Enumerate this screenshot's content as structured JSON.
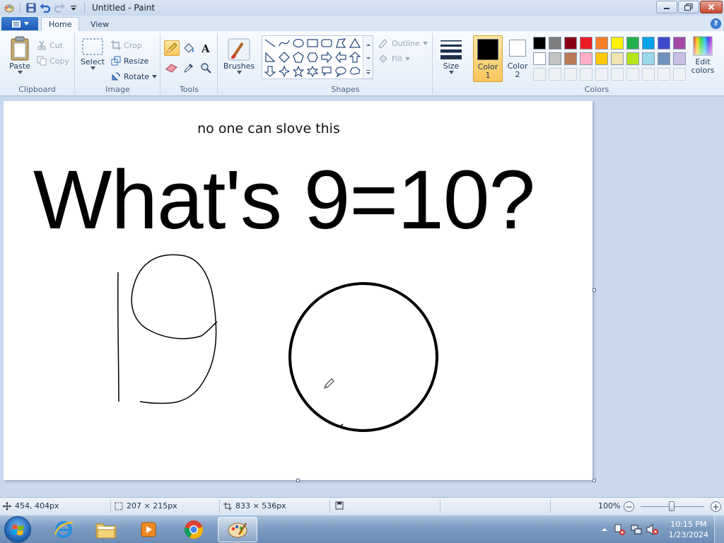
{
  "window": {
    "title": "Untitled - Paint"
  },
  "tabs": [
    {
      "label": "Home"
    },
    {
      "label": "View"
    }
  ],
  "clipboard": {
    "paste": "Paste",
    "cut": "Cut",
    "copy": "Copy",
    "label": "Clipboard"
  },
  "image": {
    "select": "Select",
    "crop": "Crop",
    "resize": "Resize",
    "rotate": "Rotate",
    "label": "Image"
  },
  "tools": {
    "label": "Tools",
    "selected": "pencil"
  },
  "brushes": {
    "label": "Brushes"
  },
  "shapes": {
    "outline": "Outline",
    "fill": "Fill",
    "label": "Shapes"
  },
  "size": {
    "label": "Size"
  },
  "colors": {
    "color1_label": "Color",
    "color1_num": "1",
    "color2_label": "Color",
    "color2_num": "2",
    "edit_label1": "Edit",
    "edit_label2": "colors",
    "label": "Colors",
    "color1": "#000000",
    "color2": "#ffffff",
    "palette_row1": [
      "#000000",
      "#7f7f7f",
      "#880015",
      "#ed1c24",
      "#ff7f27",
      "#fff200",
      "#22b14c",
      "#00a2e8",
      "#3f48cc",
      "#a349a4"
    ],
    "palette_row2": [
      "#ffffff",
      "#c3c3c3",
      "#b97a57",
      "#ffaec9",
      "#ffc90e",
      "#efe4b0",
      "#b5e61d",
      "#99d9ea",
      "#7092be",
      "#c8bfe7"
    ]
  },
  "canvas": {
    "small_text": "no one can slove this",
    "big_text": "What's 9=10?"
  },
  "status": {
    "cursor_pos": "454, 404px",
    "selection_size": "207 × 215px",
    "image_size": "833 × 536px",
    "zoom": "100%"
  },
  "taskbar": {
    "apps": [
      "internet-explorer",
      "file-explorer",
      "media-player",
      "chrome",
      "paint"
    ],
    "time": "10:15 PM",
    "date": "1/23/2024"
  }
}
